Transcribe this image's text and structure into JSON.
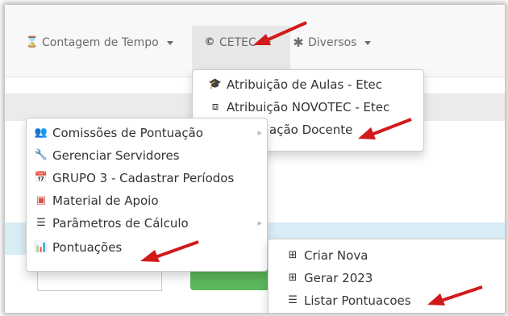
{
  "navbar": {
    "items": [
      {
        "icon": "hourglass-icon",
        "label": "Contagem de Tempo"
      },
      {
        "icon": "copyright-icon",
        "label": "CETEC"
      },
      {
        "icon": "asterisk-icon",
        "label": "Diversos"
      }
    ]
  },
  "cetec_menu": {
    "items": [
      {
        "icon": "graduation-cap-icon",
        "label": "Atribuição de Aulas - Etec"
      },
      {
        "icon": "chalkboard-teacher-icon",
        "label": "Atribuição NOVOTEC - Etec"
      },
      {
        "label": "ação Docente"
      }
    ]
  },
  "left_menu": {
    "items": [
      {
        "icon": "users-icon",
        "label": "Comissões de Pontuação"
      },
      {
        "icon": "wrench-icon",
        "label": "Gerenciar Servidores"
      },
      {
        "icon": "calendar-icon",
        "label": "GRUPO 3 - Cadastrar Períodos"
      },
      {
        "icon": "pdf-file-icon",
        "label": "Material de Apoio"
      },
      {
        "icon": "list-ol-icon",
        "label": "Parâmetros de Cálculo"
      },
      {
        "icon": "bar-chart-icon",
        "label": "Pontuações"
      }
    ]
  },
  "pontuacoes_submenu": {
    "items": [
      {
        "icon": "plus-square-icon",
        "label": "Criar Nova"
      },
      {
        "icon": "plus-square-icon",
        "label": "Gerar 2023"
      },
      {
        "icon": "list-ol-icon",
        "label": "Listar Pontuacoes"
      }
    ]
  },
  "colors": {
    "arrow": "#d11a1a",
    "pdf_icon": "#d9534f",
    "success": "#5cb85c"
  }
}
